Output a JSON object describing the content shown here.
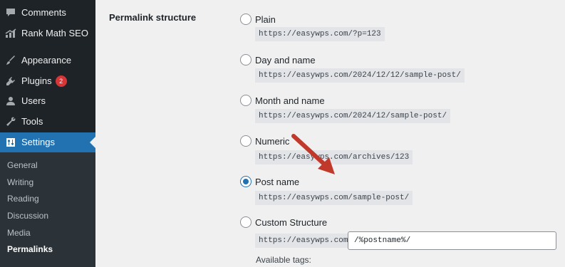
{
  "sidebar": {
    "menu": [
      {
        "label": "Comments",
        "icon": "comment-icon"
      },
      {
        "label": "Rank Math SEO",
        "icon": "rank-math-icon"
      },
      {
        "label": "Appearance",
        "icon": "paintbrush-icon"
      },
      {
        "label": "Plugins",
        "icon": "plugin-icon",
        "badge": "2"
      },
      {
        "label": "Users",
        "icon": "user-icon"
      },
      {
        "label": "Tools",
        "icon": "wrench-icon"
      },
      {
        "label": "Settings",
        "icon": "settings-icon",
        "current": true
      }
    ],
    "submenu": [
      {
        "label": "General"
      },
      {
        "label": "Writing"
      },
      {
        "label": "Reading"
      },
      {
        "label": "Discussion"
      },
      {
        "label": "Media"
      },
      {
        "label": "Permalinks",
        "active": true
      }
    ]
  },
  "permalinks": {
    "row_label": "Permalink structure",
    "options": [
      {
        "label": "Plain",
        "example": "https://easywps.com/?p=123",
        "checked": false
      },
      {
        "label": "Day and name",
        "example": "https://easywps.com/2024/12/12/sample-post/",
        "checked": false
      },
      {
        "label": "Month and name",
        "example": "https://easywps.com/2024/12/sample-post/",
        "checked": false
      },
      {
        "label": "Numeric",
        "example": "https://easywps.com/archives/123",
        "checked": false
      },
      {
        "label": "Post name",
        "example": "https://easywps.com/sample-post/",
        "checked": true
      },
      {
        "label": "Custom Structure",
        "example": "https://easywps.com",
        "checked": false
      }
    ],
    "custom_value": "/%postname%/",
    "available_tags_label": "Available tags:"
  },
  "colors": {
    "sidebar_bg": "#1d2327",
    "accent": "#2271b1",
    "badge": "#d63638",
    "annotation_arrow": "#c0392b"
  }
}
